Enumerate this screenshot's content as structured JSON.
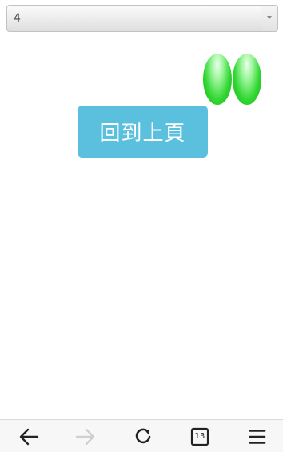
{
  "select": {
    "value": "4"
  },
  "main": {
    "back_button_label": "回到上頁"
  },
  "browser_toolbar": {
    "tab_count": "13",
    "icons": [
      "back-arrow-icon",
      "forward-arrow-icon",
      "reload-icon",
      "tabs-icon",
      "menu-icon"
    ]
  },
  "colors": {
    "button_bg": "#5bc0de",
    "egg_green": "#34d834",
    "forward_disabled": "#cfcfcf"
  }
}
